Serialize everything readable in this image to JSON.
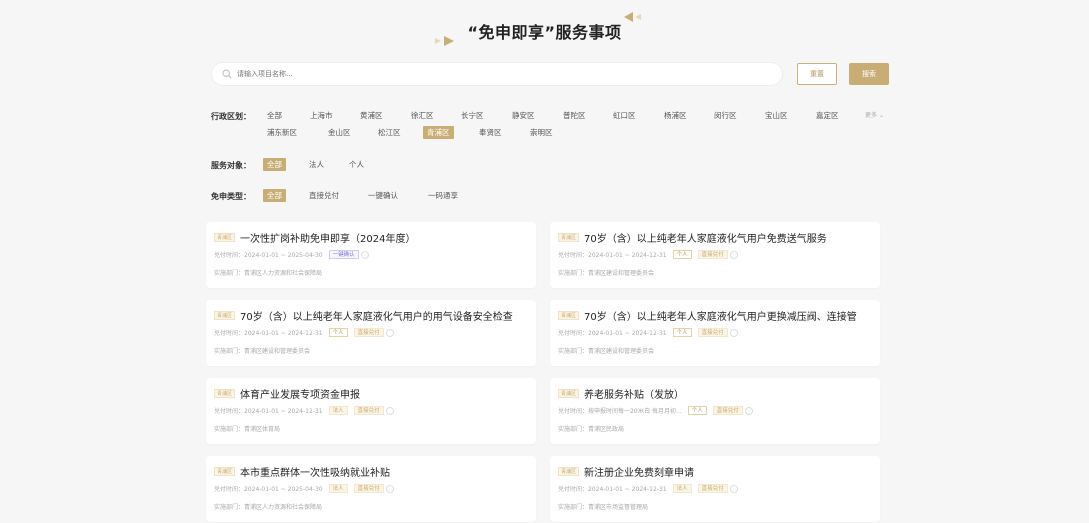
{
  "header": {
    "title": "“免申即享”服务事项"
  },
  "search": {
    "placeholder": "请输入项目名称...",
    "reset_label": "重置",
    "search_label": "搜索"
  },
  "filters": {
    "region": {
      "label": "行政区划：",
      "row1": [
        "全部",
        "上海市",
        "黄浦区",
        "徐汇区",
        "长宁区",
        "静安区",
        "普陀区",
        "虹口区",
        "杨浦区",
        "闵行区",
        "宝山区",
        "嘉定区"
      ],
      "more_label": "更多",
      "row2": [
        "浦东新区",
        "金山区",
        "松江区",
        "青浦区",
        "奉贤区",
        "崇明区"
      ],
      "active": "青浦区"
    },
    "target": {
      "label": "服务对象：",
      "options": [
        "全部",
        "法人",
        "个人"
      ],
      "active": "全部"
    },
    "type": {
      "label": "免申类型：",
      "options": [
        "全部",
        "直接兑付",
        "一键确认",
        "一码通享"
      ],
      "active": "全部"
    }
  },
  "cards": [
    {
      "district": "青浦区",
      "title": "一次性扩岗补助免申即享（2024年度）",
      "time": "兑付时间：2024-01-01 ~ 2025-04-30",
      "badges": [
        {
          "text": "一键确认",
          "style": "blue"
        }
      ],
      "dept": "实施部门：青浦区人力资源和社会保障局"
    },
    {
      "district": "青浦区",
      "title": "70岁（含）以上纯老年人家庭液化气用户免费送气服务",
      "time": "兑付时间：2024-01-01 ~ 2024-12-31",
      "badges": [
        {
          "text": "个人",
          "style": "outline"
        },
        {
          "text": "直接兑付",
          "style": "fill"
        }
      ],
      "dept": "实施部门：青浦区建设和管理委员会"
    },
    {
      "district": "青浦区",
      "title": "70岁（含）以上纯老年人家庭液化气用户的用气设备安全检查",
      "time": "兑付时间：2024-01-01 ~ 2024-12-31",
      "badges": [
        {
          "text": "个人",
          "style": "outline"
        },
        {
          "text": "直接兑付",
          "style": "fill"
        }
      ],
      "dept": "实施部门：青浦区建设和管理委员会"
    },
    {
      "district": "青浦区",
      "title": "70岁（含）以上纯老年人家庭液化气用户更换减压阀、连接管",
      "time": "兑付时间：2024-01-01 ~ 2024-12-31",
      "badges": [
        {
          "text": "个人",
          "style": "outline"
        },
        {
          "text": "直接兑付",
          "style": "fill"
        }
      ],
      "dept": "实施部门：青浦区建设和管理委员会"
    },
    {
      "district": "青浦区",
      "title": "体育产业发展专项资金申报",
      "time": "兑付时间：2024-01-01 ~ 2024-12-31",
      "badges": [
        {
          "text": "法人",
          "style": "fill"
        },
        {
          "text": "直接兑付",
          "style": "fill"
        }
      ],
      "dept": "实施部门：青浦区体育局"
    },
    {
      "district": "青浦区",
      "title": "养老服务补贴（发放）",
      "time": "兑付时间：按申报时间每一20Ж白 每月月初...",
      "badges": [
        {
          "text": "个人",
          "style": "outline"
        },
        {
          "text": "直接兑付",
          "style": "fill"
        }
      ],
      "dept": "实施部门：青浦区民政局"
    },
    {
      "district": "青浦区",
      "title": "本市重点群体一次性吸纳就业补贴",
      "time": "兑付时间：2024-01-01 ~ 2025-04-30",
      "badges": [
        {
          "text": "法人",
          "style": "fill"
        },
        {
          "text": "直接兑付",
          "style": "fill"
        }
      ],
      "dept": "实施部门：青浦区人力资源和社会保障局"
    },
    {
      "district": "青浦区",
      "title": "新注册企业免费刻章申请",
      "time": "兑付时间：2024-01-01 ~ 2024-12-31",
      "badges": [
        {
          "text": "法人",
          "style": "fill"
        },
        {
          "text": "直接兑付",
          "style": "fill"
        }
      ],
      "dept": "实施部门：青浦区市场监督管理局"
    }
  ],
  "colors": {
    "accent": "#c8ad74",
    "background": "#f6f6f6"
  }
}
